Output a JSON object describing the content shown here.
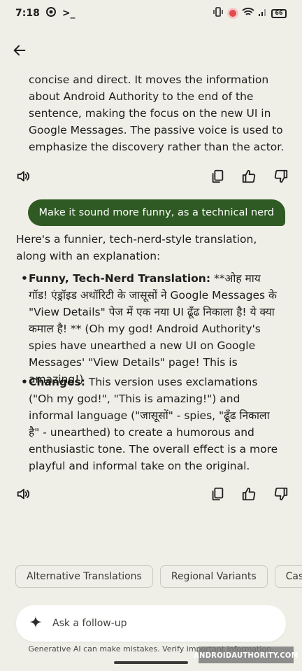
{
  "status_bar": {
    "time": "7:18",
    "terminal_glyph": ">_",
    "battery": "66"
  },
  "conversation": {
    "prev_response_text": "concise and direct. It moves the information about Android Authority to the end of the sentence, making the focus on the new UI in Google Messages.  The passive voice is used to emphasize the discovery rather than the actor.",
    "user_message": "Make it sound more funny, as a technical nerd",
    "response_intro": "Here's a funnier, tech-nerd-style translation, along with an explanation:",
    "bullets": [
      {
        "label": "Funny, Tech-Nerd Translation:",
        "text": "  **ओह माय गॉड! एंड्रॉइड अथॉरिटी के जासूसों ने Google Messages के \"View Details\" पेज में एक नया UI ढूँढ निकाला है!  ये क्या कमाल है! ** (Oh my god! Android Authority's spies have unearthed a new UI on Google Messages' \"View Details\" page! This is amazing!)"
      },
      {
        "label": "Changes:",
        "text": " This version uses exclamations (\"Oh my god!\", \"This is amazing!\") and informal language (\"जासूसों\" - spies, \"ढूँढ निकाला है\" - unearthed) to create a humorous and enthusiastic tone.  The overall effect is a more playful and informal take on the original."
      }
    ]
  },
  "icons": {
    "speaker": "speaker-icon",
    "copy": "copy-icon",
    "thumbs_up": "thumbs-up-icon",
    "thumbs_down": "thumbs-down-icon",
    "sparkle": "sparkle-icon",
    "back": "back-arrow-icon"
  },
  "chips": [
    "Alternative Translations",
    "Regional Variants",
    "Casual"
  ],
  "followup": {
    "placeholder": "Ask a follow-up"
  },
  "disclaimer": "Generative AI can make mistakes. Verify important information.",
  "watermark": "ANDROIDAUTHORITY.COM",
  "colors": {
    "background": "#efefe8",
    "user_bubble": "#2f5a23",
    "text": "#1d1d1b"
  }
}
